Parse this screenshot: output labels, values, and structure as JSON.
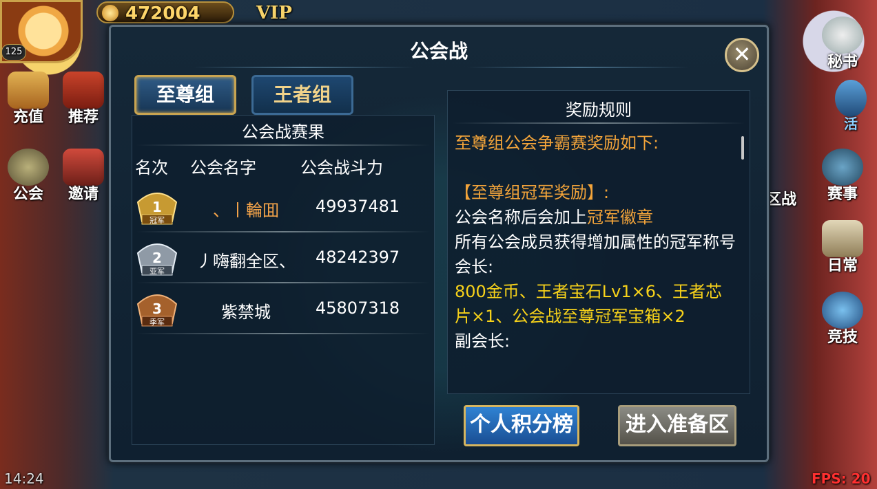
{
  "hud": {
    "level": "125",
    "gold": "472004",
    "vip": "VIP",
    "left_buttons": [
      "充值",
      "推荐",
      "公会",
      "邀请"
    ],
    "right_buttons": [
      "秘书",
      "活",
      "区战",
      "赛事",
      "日常",
      "竞技"
    ],
    "clock": "14:24",
    "fps": "FPS: 20"
  },
  "dialog": {
    "title": "公会战",
    "close_symbol": "✕",
    "tabs": [
      {
        "label": "至尊组",
        "active": true
      },
      {
        "label": "王者组",
        "active": false
      }
    ],
    "results": {
      "title": "公会战赛果",
      "columns": [
        "名次",
        "公会名字",
        "公会战斗力"
      ],
      "rows": [
        {
          "rank": "1",
          "medal": "冠军",
          "name": "、丨輪囬",
          "power": "49937481"
        },
        {
          "rank": "2",
          "medal": "亚军",
          "name": "丿嗨翻全区、",
          "power": "48242397"
        },
        {
          "rank": "3",
          "medal": "季军",
          "name": "紫禁城",
          "power": "45807318"
        }
      ]
    },
    "rewards": {
      "title": "奖励规则",
      "intro": "至尊组公会争霸赛奖励如下:",
      "champion_header": "【至尊组冠军奖励】:",
      "line1_prefix": "公会名称后会加上",
      "line1_highlight": "冠军徽章",
      "line2": "所有公会成员获得增加属性的冠军称号",
      "leader_label": "会长:",
      "leader_rewards": "800金币、王者宝石Lv1×6、王者芯片×1、公会战至尊冠军宝箱×2",
      "vice_label": "副会长:"
    },
    "buttons": {
      "rank": "个人积分榜",
      "prep": "进入准备区"
    }
  }
}
